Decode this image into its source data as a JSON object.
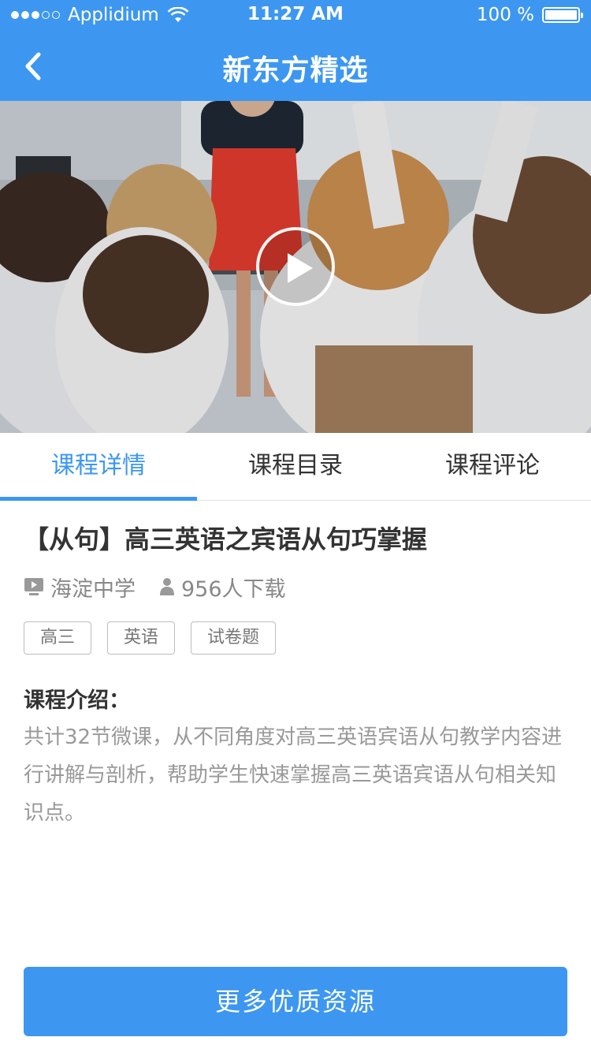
{
  "status_bar": {
    "carrier": "Applidium",
    "time": "11:27 AM",
    "battery": "100 %"
  },
  "nav": {
    "title": "新东方精选",
    "back_icon": "chevron-left-icon"
  },
  "video": {
    "play_icon": "play-icon"
  },
  "tabs": [
    {
      "label": "课程详情",
      "active": true
    },
    {
      "label": "课程目录",
      "active": false
    },
    {
      "label": "课程评论",
      "active": false
    }
  ],
  "course": {
    "title": "【从句】高三英语之宾语从句巧掌握",
    "school": "海淀中学",
    "downloads": "956人下载",
    "tags": [
      "高三",
      "英语",
      "试卷题"
    ],
    "intro_label": "课程介绍：",
    "intro_text": "共计32节微课，从不同角度对高三英语宾语从句教学内容进行讲解与剖析，帮助学生快速掌握高三英语宾语从句相关知识点。"
  },
  "footer": {
    "button_label": "更多优质资源"
  },
  "colors": {
    "primary": "#3d97f0",
    "text_dark": "#333333",
    "text_gray": "#999999"
  }
}
